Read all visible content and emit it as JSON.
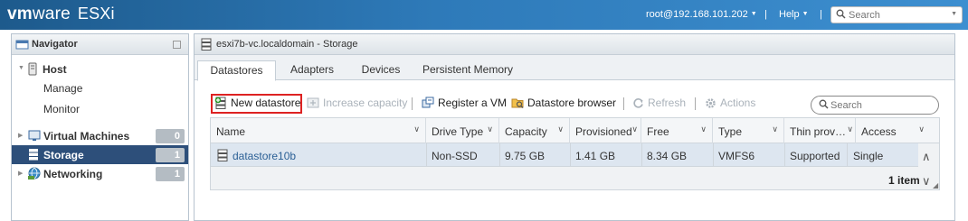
{
  "header": {
    "brand_vm": "vm",
    "brand_ware": "ware",
    "brand_product": "ESXi",
    "user": "root@192.168.101.202",
    "help": "Help",
    "search_placeholder": "Search"
  },
  "navigator": {
    "title": "Navigator",
    "items": [
      {
        "label": "Host",
        "type": "section"
      },
      {
        "label": "Manage",
        "type": "sub"
      },
      {
        "label": "Monitor",
        "type": "sub"
      },
      {
        "label": "Virtual Machines",
        "count": "0"
      },
      {
        "label": "Storage",
        "count": "1",
        "active": true
      },
      {
        "label": "Networking",
        "count": "1"
      }
    ]
  },
  "main": {
    "title": "esxi7b-vc.localdomain - Storage",
    "tabs": [
      {
        "label": "Datastores",
        "active": true
      },
      {
        "label": "Adapters"
      },
      {
        "label": "Devices"
      },
      {
        "label": "Persistent Memory"
      }
    ],
    "toolbar": {
      "new_datastore": "New datastore",
      "increase_capacity": "Increase capacity",
      "register_vm": "Register a VM",
      "datastore_browser": "Datastore browser",
      "refresh": "Refresh",
      "actions": "Actions",
      "search_placeholder": "Search"
    },
    "grid": {
      "columns": [
        "Name",
        "Drive Type",
        "Capacity",
        "Provisioned",
        "Free",
        "Type",
        "Thin prov…",
        "Access"
      ],
      "rows": [
        {
          "name": "datastore10b",
          "drive_type": "Non-SSD",
          "capacity": "9.75 GB",
          "provisioned": "1.41 GB",
          "free": "8.34 GB",
          "type": "VMFS6",
          "thin": "Supported",
          "access": "Single"
        }
      ],
      "footer": "1 item"
    }
  },
  "colors": {
    "topbar": "#2e7ab9",
    "active_nav": "#2d4f7a",
    "highlight": "#dd2222"
  }
}
